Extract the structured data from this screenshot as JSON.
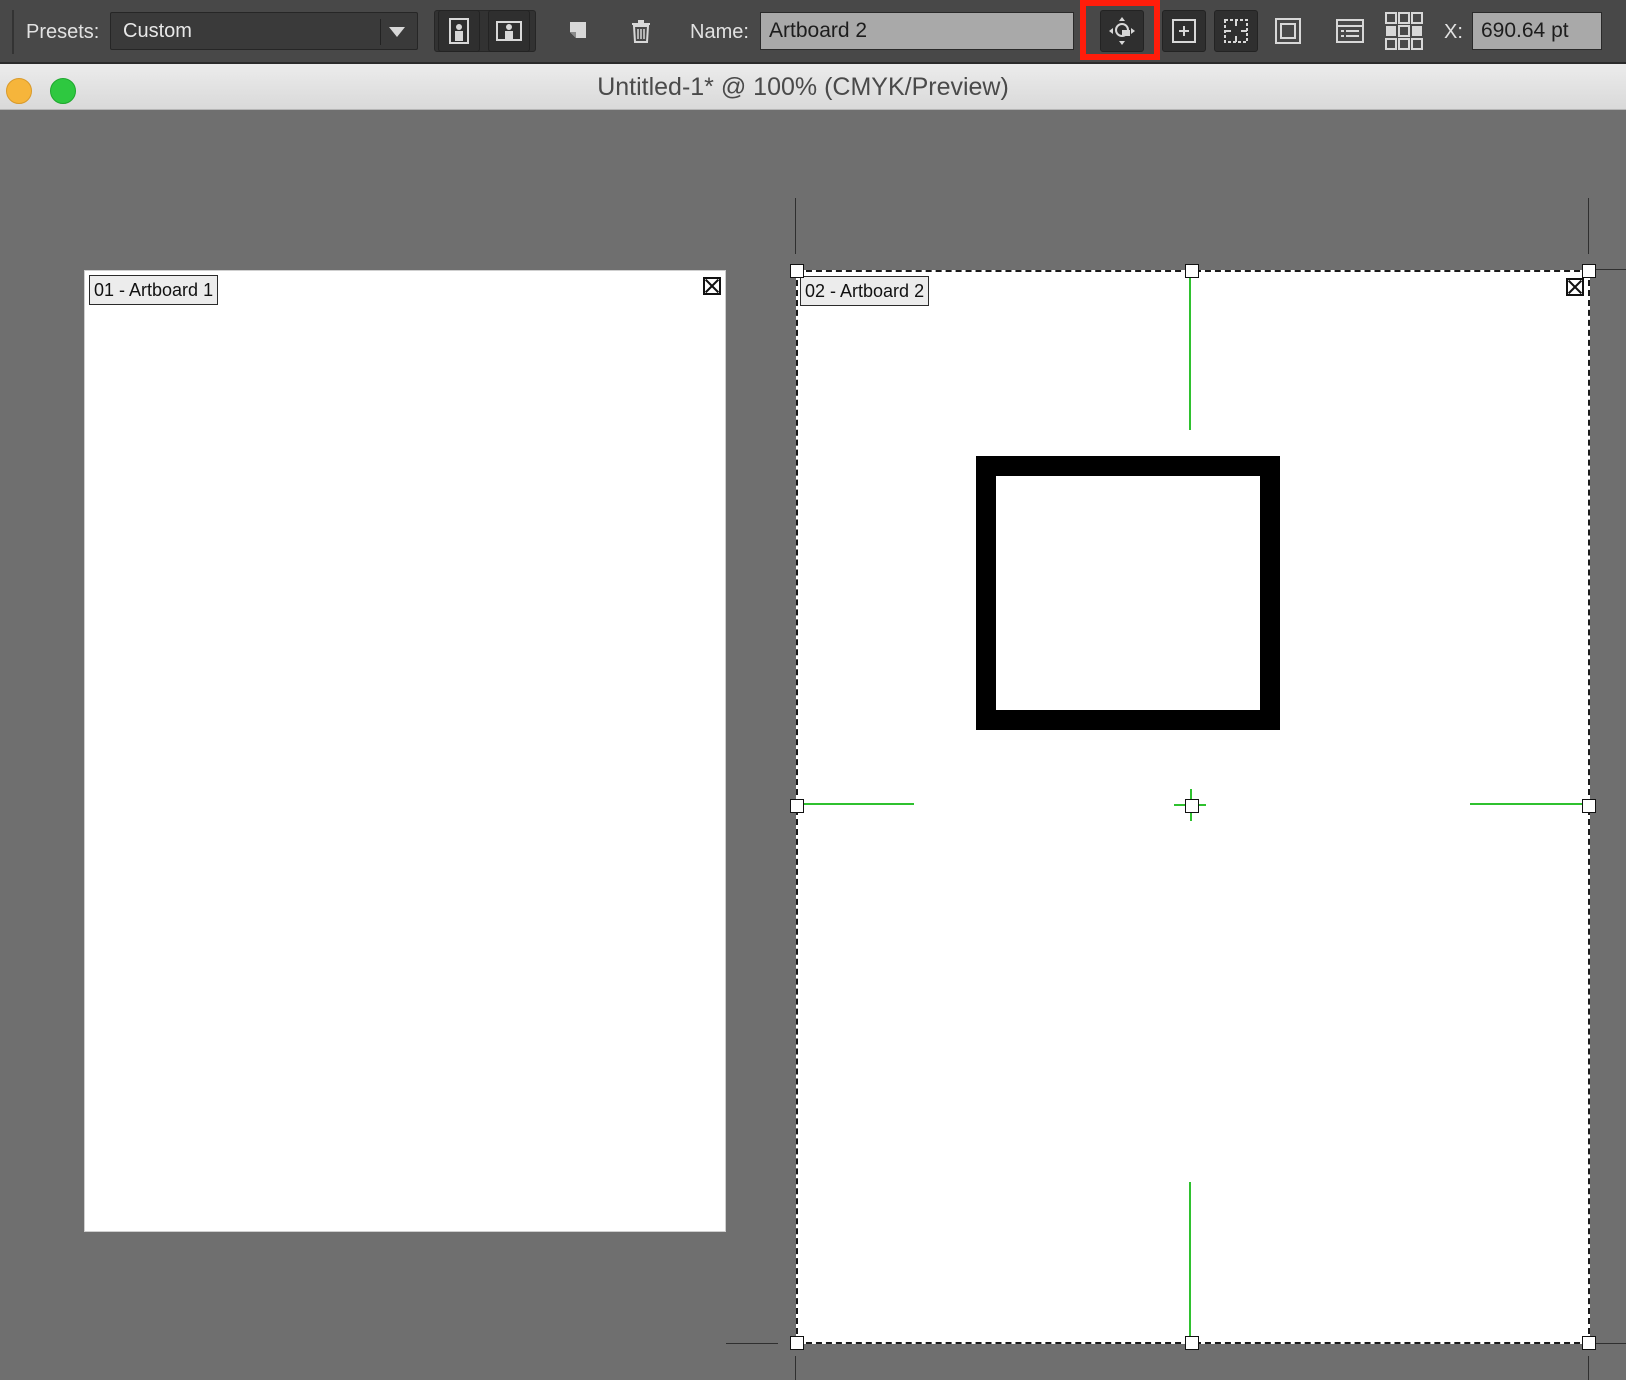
{
  "control_bar": {
    "presets_label": "Presets:",
    "preset_value": "Custom",
    "name_label": "Name:",
    "name_value": "Artboard 2",
    "x_label": "X:",
    "x_value": "690.64 pt"
  },
  "icons": {
    "portrait": "portrait-orientation-icon",
    "landscape": "landscape-orientation-icon",
    "new_artboard": "new-artboard-icon",
    "delete": "trash-icon",
    "move_copy": "move-copy-artwork-icon",
    "center_mark": "show-center-mark-icon",
    "cross_hairs": "show-cross-hairs-icon",
    "video_safe": "show-video-safe-areas-icon",
    "artboard_options": "artboard-options-icon",
    "rearrange": "rearrange-artboards-icon"
  },
  "highlight_color": "#ff1d0b",
  "guide_color": "#2fc12f",
  "window": {
    "title": "Untitled-1* @ 100% (CMYK/Preview)"
  },
  "artboards": [
    {
      "label": "01 - Artboard 1"
    },
    {
      "label": "02 - Artboard 2"
    }
  ]
}
